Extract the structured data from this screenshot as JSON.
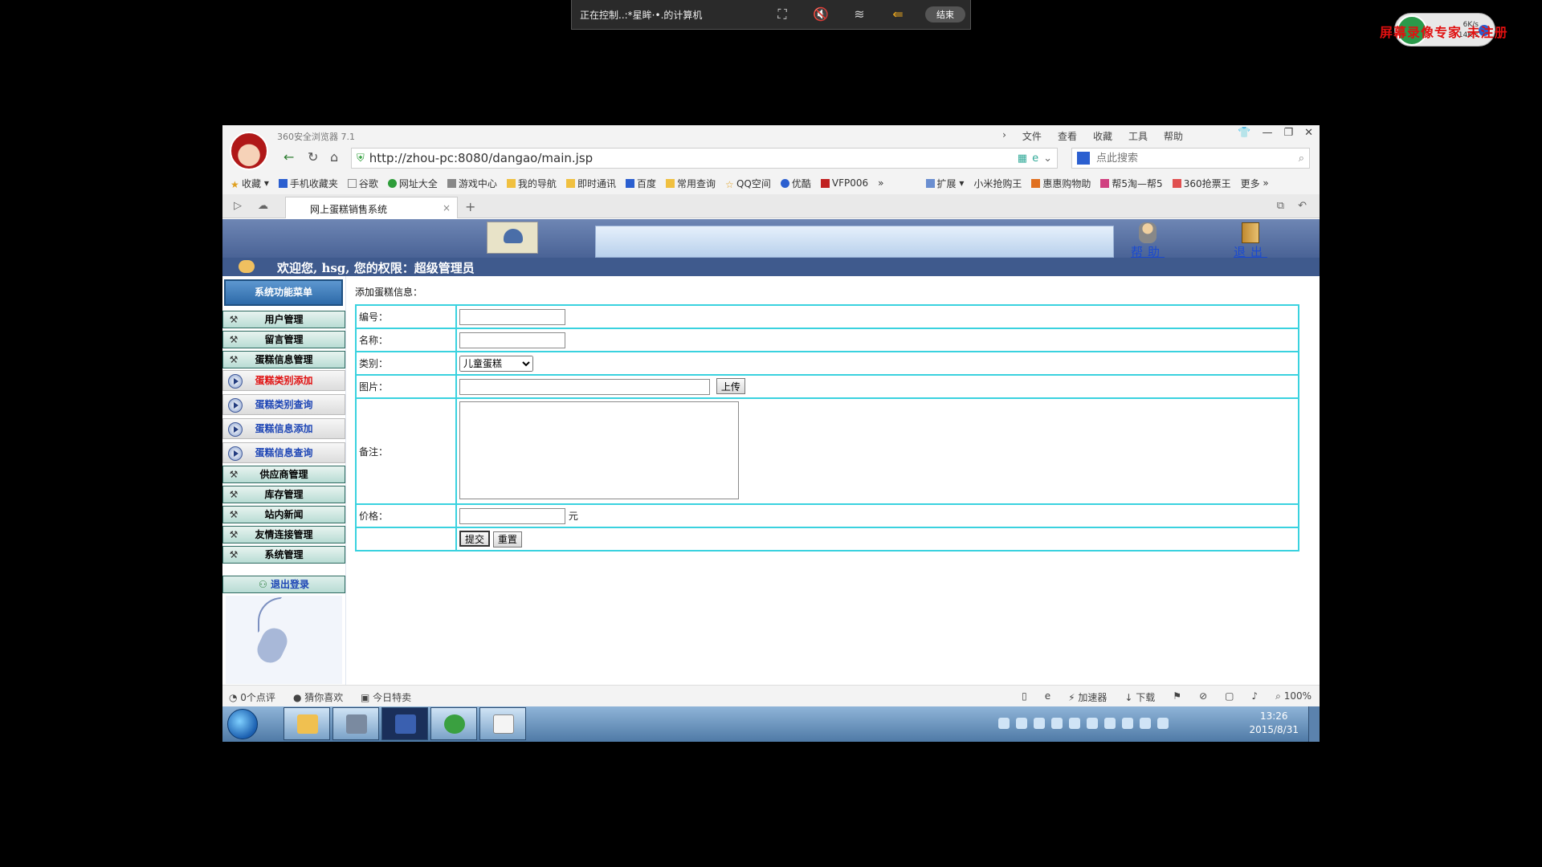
{
  "remote": {
    "title": "正在控制..:*星眸·•.的计算机",
    "end_label": "结束"
  },
  "watermark": {
    "text": "屏幕录像专家 未注册",
    "speed_up": "6K/s",
    "speed_down": "14K/s"
  },
  "browser": {
    "app_title": "360安全浏览器 7.1",
    "menus": [
      "文件",
      "查看",
      "收藏",
      "工具",
      "帮助"
    ],
    "url": "http://zhou-pc:8080/dangao/main.jsp",
    "search_placeholder": "点此搜索",
    "bookmarks": [
      "收藏",
      "手机收藏夹",
      "谷歌",
      "网址大全",
      "游戏中心",
      "我的导航",
      "即时通讯",
      "百度",
      "常用查询",
      "QQ空间",
      "优酷",
      "VFP006"
    ],
    "bookmarks_right": [
      "扩展",
      "小米抢购王",
      "惠惠购物助",
      "帮5淘—帮5",
      "360抢票王",
      "更多"
    ],
    "tab_title": "网上蛋糕销售系统",
    "status_left": [
      "0个点评",
      "猜你喜欢",
      "今日特卖"
    ],
    "status_right": [
      "加速器",
      "下载",
      "100%"
    ]
  },
  "app": {
    "help_label": "帮助",
    "exit_label": "退出",
    "welcome": "欢迎您, hsg, 您的权限：超级管理员",
    "menu_title": "系统功能菜单",
    "menu": [
      "用户管理",
      "留言管理",
      "蛋糕信息管理"
    ],
    "submenu": [
      "蛋糕类别添加",
      "蛋糕类别查询",
      "蛋糕信息添加",
      "蛋糕信息查询"
    ],
    "menu2": [
      "供应商管理",
      "库存管理",
      "站内新闻",
      "友情连接管理",
      "系统管理"
    ],
    "logout_label": "退出登录"
  },
  "form": {
    "title": "添加蛋糕信息：",
    "labels": {
      "code": "编号：",
      "name": "名称：",
      "category": "类别：",
      "image": "图片：",
      "note": "备注：",
      "price": "价格："
    },
    "category_selected": "儿童蛋糕",
    "upload_label": "上传",
    "price_unit": "元",
    "submit_label": "提交",
    "reset_label": "重置"
  },
  "taskbar": {
    "time": "13:26",
    "date": "2015/8/31"
  }
}
